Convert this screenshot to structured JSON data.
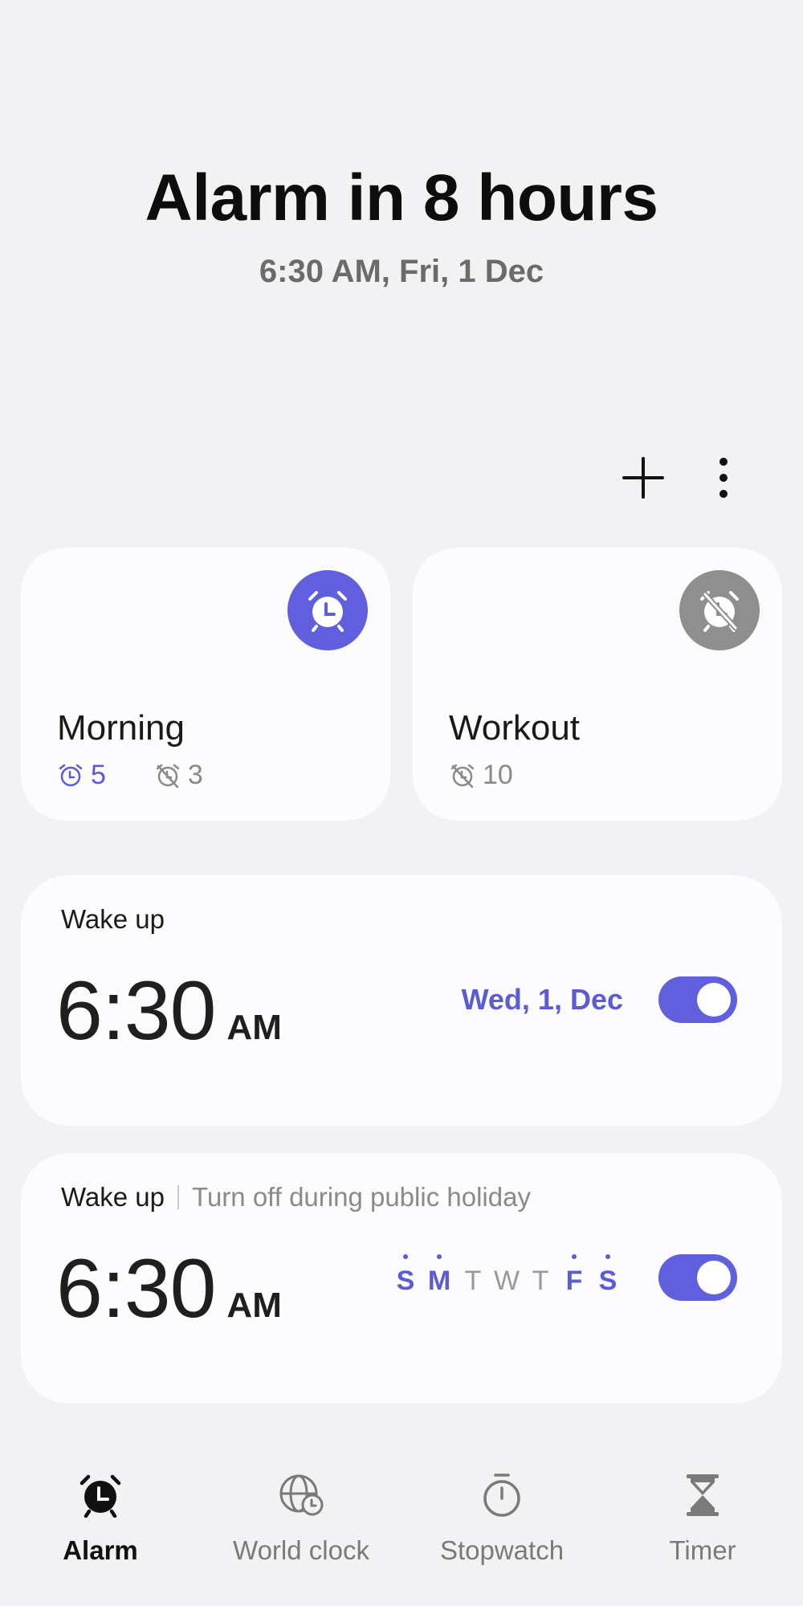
{
  "header": {
    "title": "Alarm in 8 hours",
    "subtitle": "6:30 AM, Fri, 1 Dec"
  },
  "toolbar": {
    "add_icon": "plus-icon",
    "more_icon": "more-vertical-icon"
  },
  "groups": [
    {
      "name": "Morning",
      "status": "on",
      "badge_icon": "alarm-clock-icon",
      "on_count": "5",
      "off_count": "3"
    },
    {
      "name": "Workout",
      "status": "off",
      "badge_icon": "alarm-off-icon",
      "off_count": "10"
    }
  ],
  "alarms": [
    {
      "label": "Wake up",
      "time": "6:30",
      "ampm": "AM",
      "date": "Wed, 1, Dec",
      "enabled": true
    },
    {
      "label": "Wake up",
      "note": "Turn off during public holiday",
      "time": "6:30",
      "ampm": "AM",
      "days": [
        {
          "letter": "S",
          "on": true
        },
        {
          "letter": "M",
          "on": true
        },
        {
          "letter": "T",
          "on": false
        },
        {
          "letter": "W",
          "on": false
        },
        {
          "letter": "T",
          "on": false
        },
        {
          "letter": "F",
          "on": true
        },
        {
          "letter": "S",
          "on": true
        }
      ],
      "enabled": true
    }
  ],
  "bottom_nav": {
    "items": [
      {
        "label": "Alarm",
        "icon": "alarm-clock-icon",
        "active": true
      },
      {
        "label": "World clock",
        "icon": "globe-clock-icon",
        "active": false
      },
      {
        "label": "Stopwatch",
        "icon": "stopwatch-icon",
        "active": false
      },
      {
        "label": "Timer",
        "icon": "hourglass-icon",
        "active": false
      }
    ]
  },
  "colors": {
    "accent": "#6060df",
    "accent_text": "#5b5bd6",
    "inactive_badge": "#8f8f8f",
    "background": "#f2f2f4",
    "card": "#fcfcfe"
  }
}
